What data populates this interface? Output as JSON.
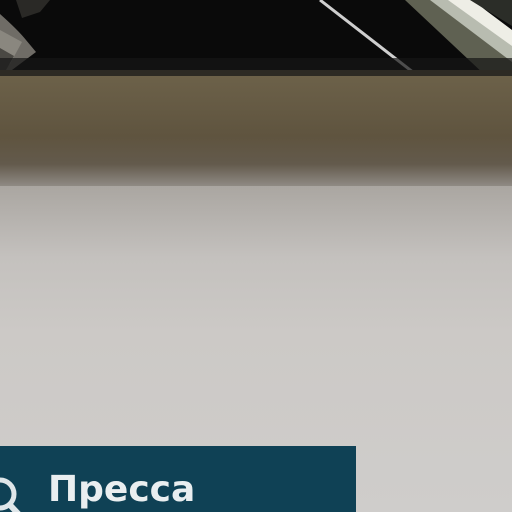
{
  "hero": {
    "image": "staircase-ceiling-photo"
  },
  "press_card": {
    "label": "Пресса",
    "icon": "search-icon",
    "background_color": "#0f4155",
    "text_color": "#e9eef0"
  }
}
